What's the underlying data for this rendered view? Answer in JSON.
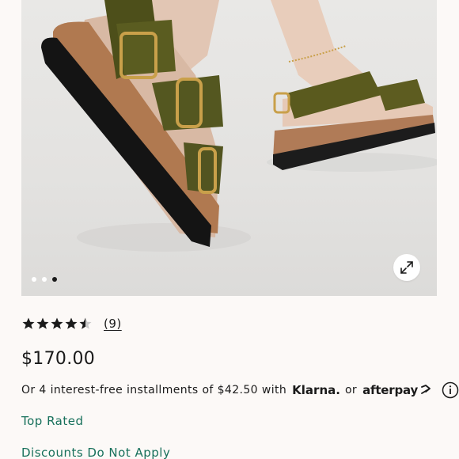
{
  "product": {
    "image": {
      "alt_icon": "sandal-photo",
      "carousel_count": 3,
      "carousel_active": 3
    },
    "rating": {
      "value": 4.5,
      "max": 5,
      "count_label": "(9)"
    },
    "price": "$170.00",
    "installments": {
      "prefix": "Or 4 interest-free installments of $42.50 with",
      "provider_one": "Klarna.",
      "separator": "or",
      "provider_two": "afterpay"
    },
    "badges": {
      "top_rated": "Top Rated",
      "discounts": "Discounts Do Not Apply"
    }
  },
  "colors": {
    "accent_green": "#17705b",
    "text": "#1a1a1a",
    "background": "#fcf9f7"
  }
}
